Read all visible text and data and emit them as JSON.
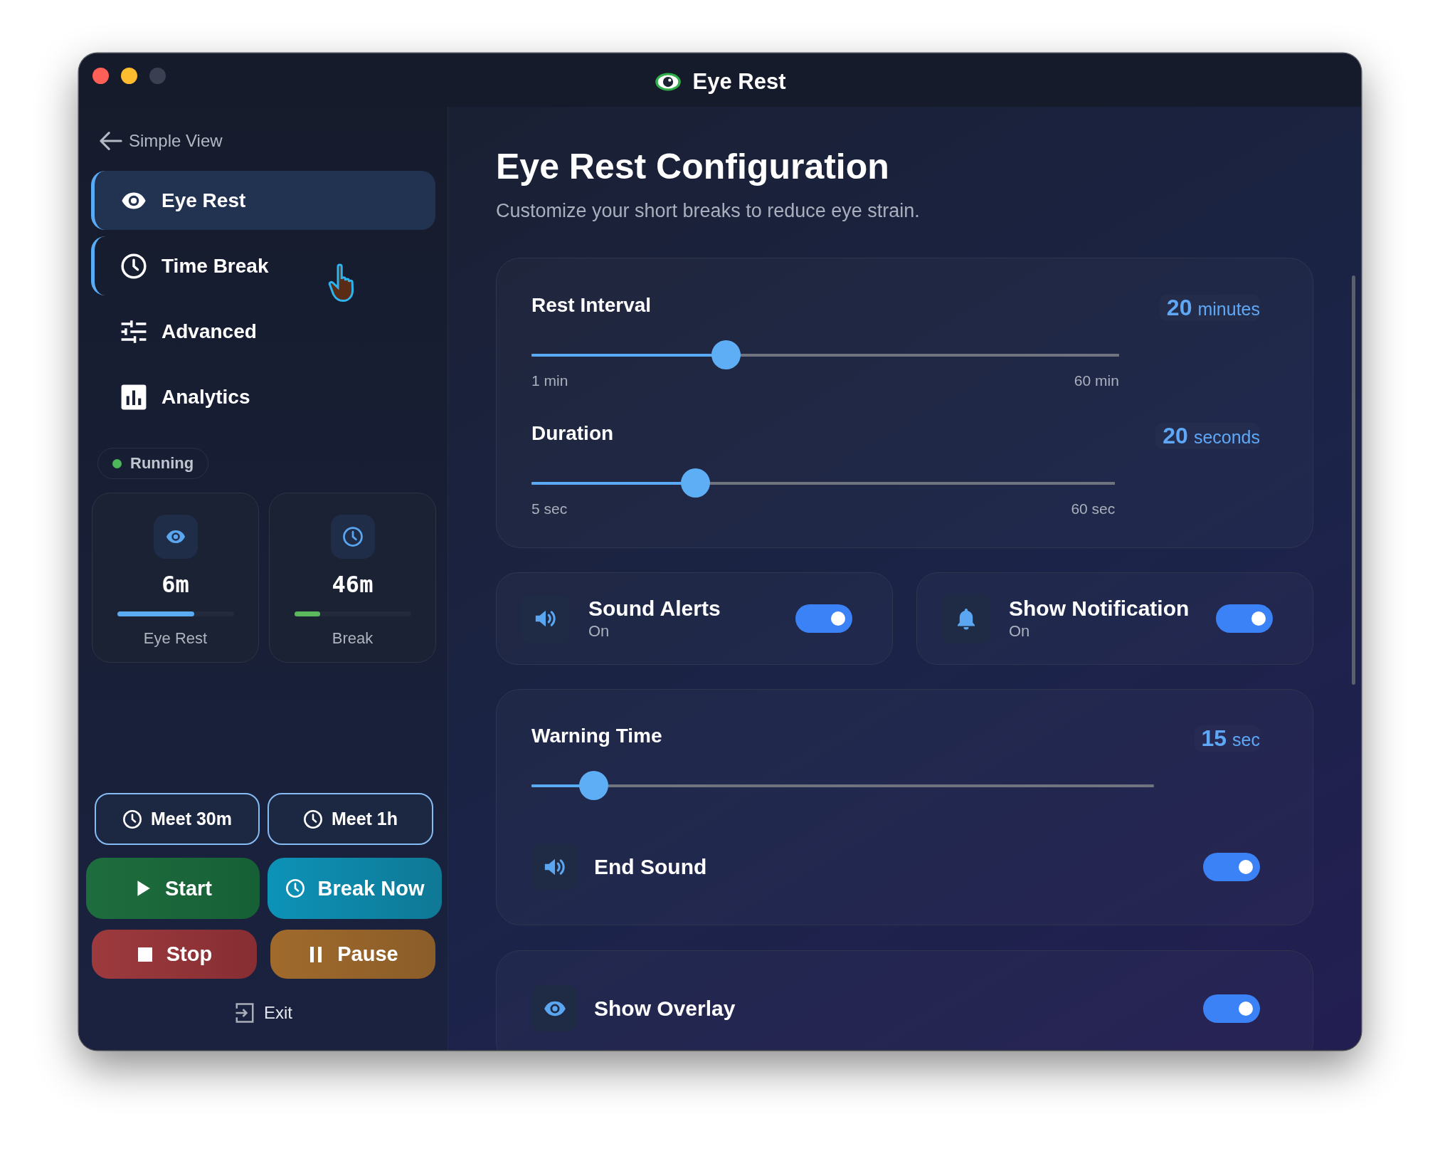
{
  "window": {
    "title": "Eye Rest"
  },
  "window_controls": [
    {
      "kind": "close",
      "disabled": false
    },
    {
      "kind": "minimize",
      "disabled": false
    },
    {
      "kind": "zoom",
      "disabled": true
    }
  ],
  "sidebar": {
    "back_link": "Simple View",
    "nav": [
      {
        "label": "Eye Rest",
        "kind": "eye",
        "selected": true,
        "hovered": false
      },
      {
        "label": "Time Break",
        "kind": "clock",
        "selected": false,
        "hovered": true
      },
      {
        "label": "Advanced",
        "kind": "sliders",
        "selected": false,
        "hovered": false
      },
      {
        "label": "Analytics",
        "kind": "chart",
        "selected": false,
        "hovered": false
      }
    ],
    "status": {
      "label": "Running",
      "active": true
    },
    "stats": [
      {
        "kind": "eye",
        "value": "6m",
        "label": "Eye Rest",
        "level": 0.66,
        "color": "#5aabf2"
      },
      {
        "kind": "clock",
        "value": "46m",
        "label": "Break",
        "level": 0.22,
        "color": "#5cb85c"
      }
    ],
    "quick_buttons": [
      {
        "label": "Meet 30m"
      },
      {
        "label": "Meet 1h"
      }
    ],
    "actions": [
      {
        "label": "Start",
        "kind": "start"
      },
      {
        "label": "Break Now",
        "kind": "break"
      },
      {
        "label": "Stop",
        "kind": "stop"
      },
      {
        "label": "Pause",
        "kind": "pause"
      }
    ],
    "exit": "Exit"
  },
  "main": {
    "title": "Eye Rest Configuration",
    "subtitle": "Customize your short breaks to reduce eye strain.",
    "timing_card": {
      "sliders": [
        {
          "label": "Rest Interval",
          "value": "20",
          "unit": "minutes",
          "level": 0.33,
          "min_label": "1 min",
          "max_label": "60 min"
        },
        {
          "label": "Duration",
          "value": "20",
          "unit": "seconds",
          "level": 0.28,
          "min_label": "5 sec",
          "max_label": "60 sec"
        }
      ]
    },
    "toggle_cards": [
      {
        "kind": "speaker",
        "label": "Sound Alerts",
        "status": "On",
        "on": true
      },
      {
        "kind": "bell",
        "label": "Show Notification",
        "status": "On",
        "on": true
      }
    ],
    "warning_card": {
      "slider": {
        "label": "Warning Time",
        "value": "15",
        "unit": "sec",
        "level": 0.1
      },
      "toggle": {
        "kind": "speaker",
        "label": "End Sound",
        "on": true
      }
    },
    "overlay_card": {
      "toggle": {
        "kind": "eye",
        "label": "Show Overlay",
        "on": true
      }
    }
  }
}
